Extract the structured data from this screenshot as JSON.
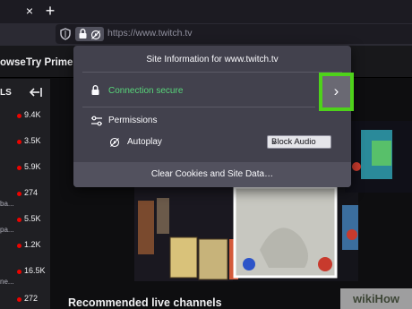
{
  "browser": {
    "close_glyph": "×",
    "newtab_glyph": "+",
    "url": "https://www.twitch.tv"
  },
  "twitch": {
    "nav": [
      "owse",
      "Try Prime"
    ],
    "sidebar_header": "LS",
    "sidebar_items": [
      {
        "count": "9.4K"
      },
      {
        "count": "3.5K"
      },
      {
        "count": "5.9K"
      },
      {
        "count": "274"
      },
      {
        "count": "5.5K"
      },
      {
        "count": "1.2K"
      },
      {
        "count": "16.5K"
      },
      {
        "count": "272"
      }
    ],
    "sidebar_subs": [
      "ba...",
      "pa...",
      "ne..."
    ],
    "recommended_title": "Recommended live channels",
    "live_color": "#eb0400"
  },
  "popup": {
    "title": "Site Information for www.twitch.tv",
    "connection": "Connection secure",
    "connection_color": "#58d67a",
    "permissions": "Permissions",
    "autoplay": "Autoplay",
    "autoplay_value": "Block Audio",
    "clear": "Clear Cookies and Site Data…",
    "highlight_color": "#4ed21a"
  },
  "watermark": "wikiHow"
}
